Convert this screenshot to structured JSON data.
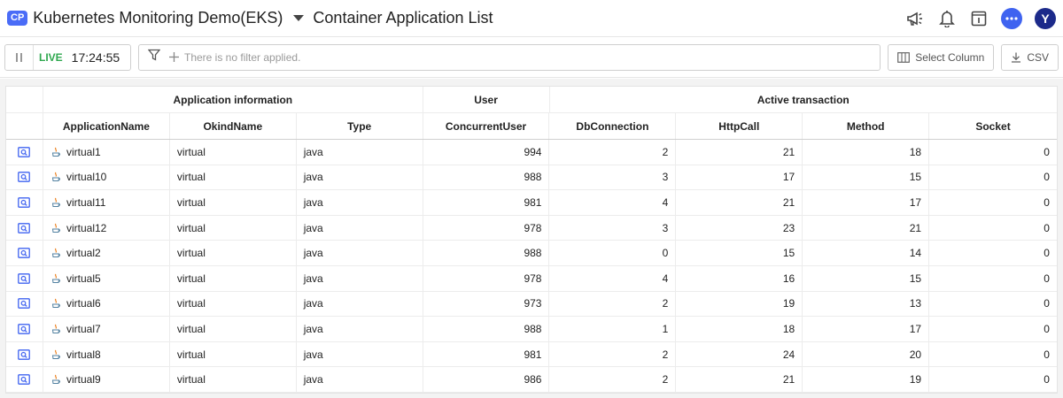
{
  "header": {
    "badge": "CP",
    "project": "Kubernetes Monitoring Demo(EKS)",
    "page_title": "Container Application List"
  },
  "toolbar": {
    "live_label": "LIVE",
    "time": "17:24:55",
    "filter_placeholder": "There is no filter applied.",
    "select_column_label": "Select Column",
    "csv_label": "CSV"
  },
  "table": {
    "groups": [
      "Application information",
      "User",
      "Active transaction"
    ],
    "columns": [
      "ApplicationName",
      "OkindName",
      "Type",
      "ConcurrentUser",
      "DbConnection",
      "HttpCall",
      "Method",
      "Socket"
    ],
    "rows": [
      {
        "name": "virtual1",
        "okind": "virtual",
        "type": "java",
        "users": "994",
        "db": "2",
        "http": "21",
        "method": "18",
        "socket": "0"
      },
      {
        "name": "virtual10",
        "okind": "virtual",
        "type": "java",
        "users": "988",
        "db": "3",
        "http": "17",
        "method": "15",
        "socket": "0"
      },
      {
        "name": "virtual11",
        "okind": "virtual",
        "type": "java",
        "users": "981",
        "db": "4",
        "http": "21",
        "method": "17",
        "socket": "0"
      },
      {
        "name": "virtual12",
        "okind": "virtual",
        "type": "java",
        "users": "978",
        "db": "3",
        "http": "23",
        "method": "21",
        "socket": "0"
      },
      {
        "name": "virtual2",
        "okind": "virtual",
        "type": "java",
        "users": "988",
        "db": "0",
        "http": "15",
        "method": "14",
        "socket": "0"
      },
      {
        "name": "virtual5",
        "okind": "virtual",
        "type": "java",
        "users": "978",
        "db": "4",
        "http": "16",
        "method": "15",
        "socket": "0"
      },
      {
        "name": "virtual6",
        "okind": "virtual",
        "type": "java",
        "users": "973",
        "db": "2",
        "http": "19",
        "method": "13",
        "socket": "0"
      },
      {
        "name": "virtual7",
        "okind": "virtual",
        "type": "java",
        "users": "988",
        "db": "1",
        "http": "18",
        "method": "17",
        "socket": "0"
      },
      {
        "name": "virtual8",
        "okind": "virtual",
        "type": "java",
        "users": "981",
        "db": "2",
        "http": "24",
        "method": "20",
        "socket": "0"
      },
      {
        "name": "virtual9",
        "okind": "virtual",
        "type": "java",
        "users": "986",
        "db": "2",
        "http": "21",
        "method": "19",
        "socket": "0"
      }
    ]
  },
  "icons": {
    "announce": "megaphone-icon",
    "notify": "bell-icon",
    "panel": "info-panel-icon",
    "chat": "chat-icon",
    "row_detail": "detail-search-icon",
    "app_type": "java-icon"
  },
  "colors": {
    "accent": "#4a6cf7",
    "live": "#2fa84f",
    "avatar": "#1c2a8a"
  },
  "user": {
    "avatar_initial": "Y"
  }
}
